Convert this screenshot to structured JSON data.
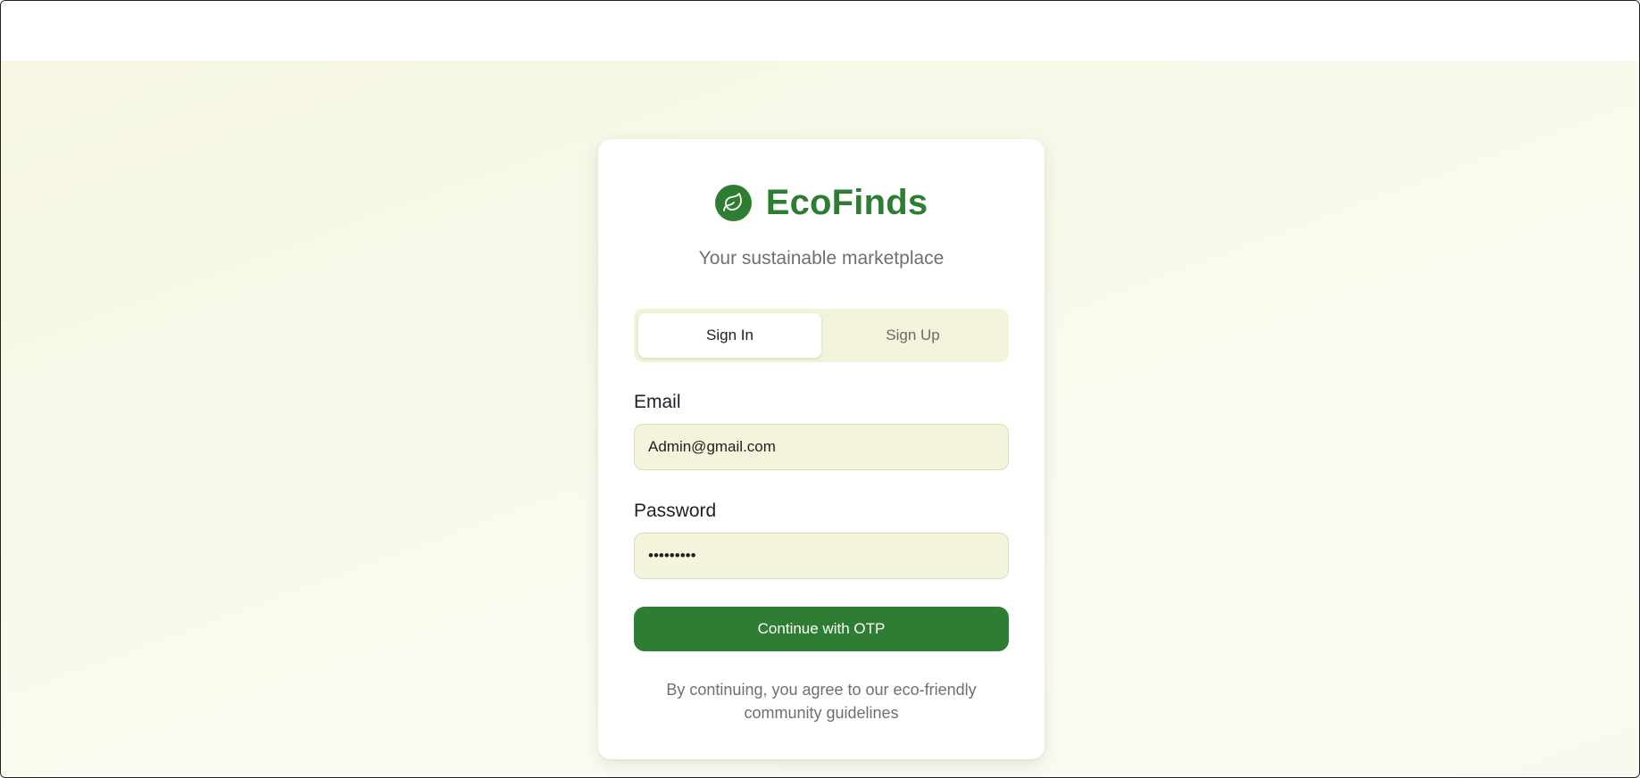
{
  "brand": {
    "name": "EcoFinds",
    "tagline": "Your sustainable marketplace",
    "logo_icon": "leaf-icon",
    "color": "#2e7d32"
  },
  "tabs": [
    {
      "label": "Sign In",
      "active": true
    },
    {
      "label": "Sign Up",
      "active": false
    }
  ],
  "form": {
    "email": {
      "label": "Email",
      "value": "Admin@gmail.com"
    },
    "password": {
      "label": "Password",
      "value": "adminpass"
    },
    "submit_label": "Continue with OTP"
  },
  "footnote": "By continuing, you agree to our eco-friendly community guidelines",
  "colors": {
    "accent": "#2e7d32",
    "input_bg": "#f4f4dc",
    "page_bg": "#f7f7e6"
  }
}
